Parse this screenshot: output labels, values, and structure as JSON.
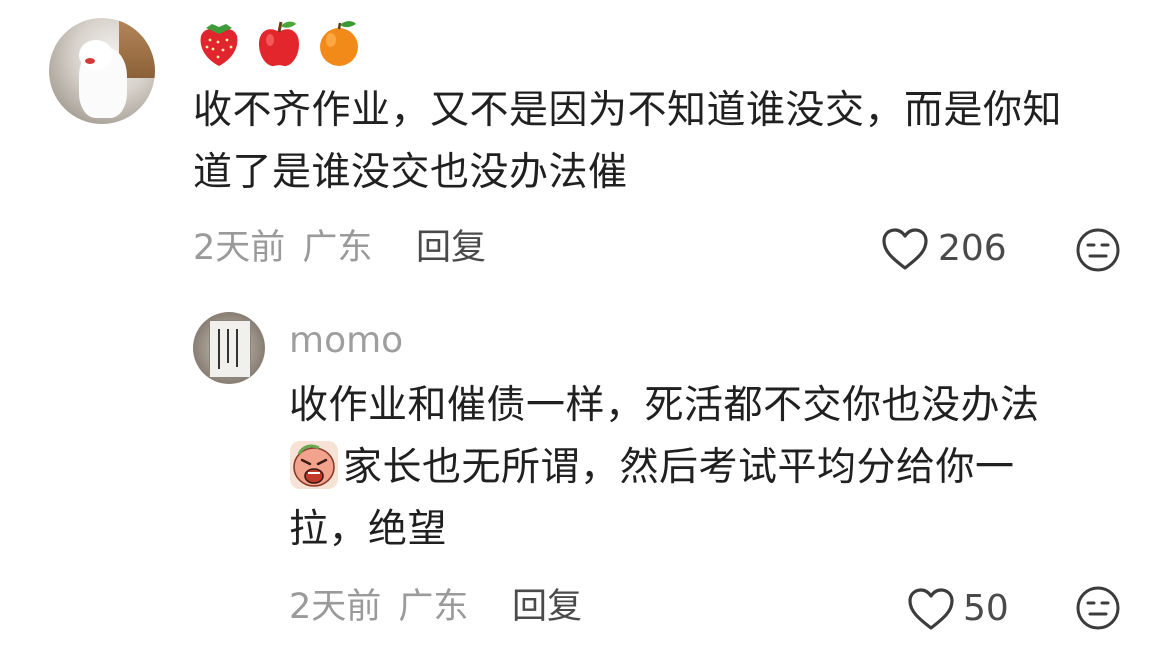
{
  "comments": [
    {
      "emojis": [
        "strawberry",
        "apple",
        "tangerine"
      ],
      "text_line1": "收不齐作业，又不是因为不知道谁没交，而是你知",
      "text_line2": "道了是谁没交也没办法催",
      "time": "2天前",
      "location": "广东",
      "reply_label": "回复",
      "likes": "206"
    }
  ],
  "replies": [
    {
      "username": "momo",
      "text_line1": "收作业和催债一样，死活都不交你也没办法",
      "text_line2": "家长也无所谓，然后考试平均分给你一",
      "text_line3": "拉，绝望",
      "sticker": "crying-face-sticker",
      "time": "2天前",
      "location": "广东",
      "reply_label": "回复",
      "likes": "50"
    }
  ],
  "icons": {
    "like": "heart-outline-icon",
    "react": "neutral-face-icon"
  },
  "colors": {
    "text": "#202020",
    "meta": "#9a9a9a",
    "icon": "#3c3c3c"
  }
}
